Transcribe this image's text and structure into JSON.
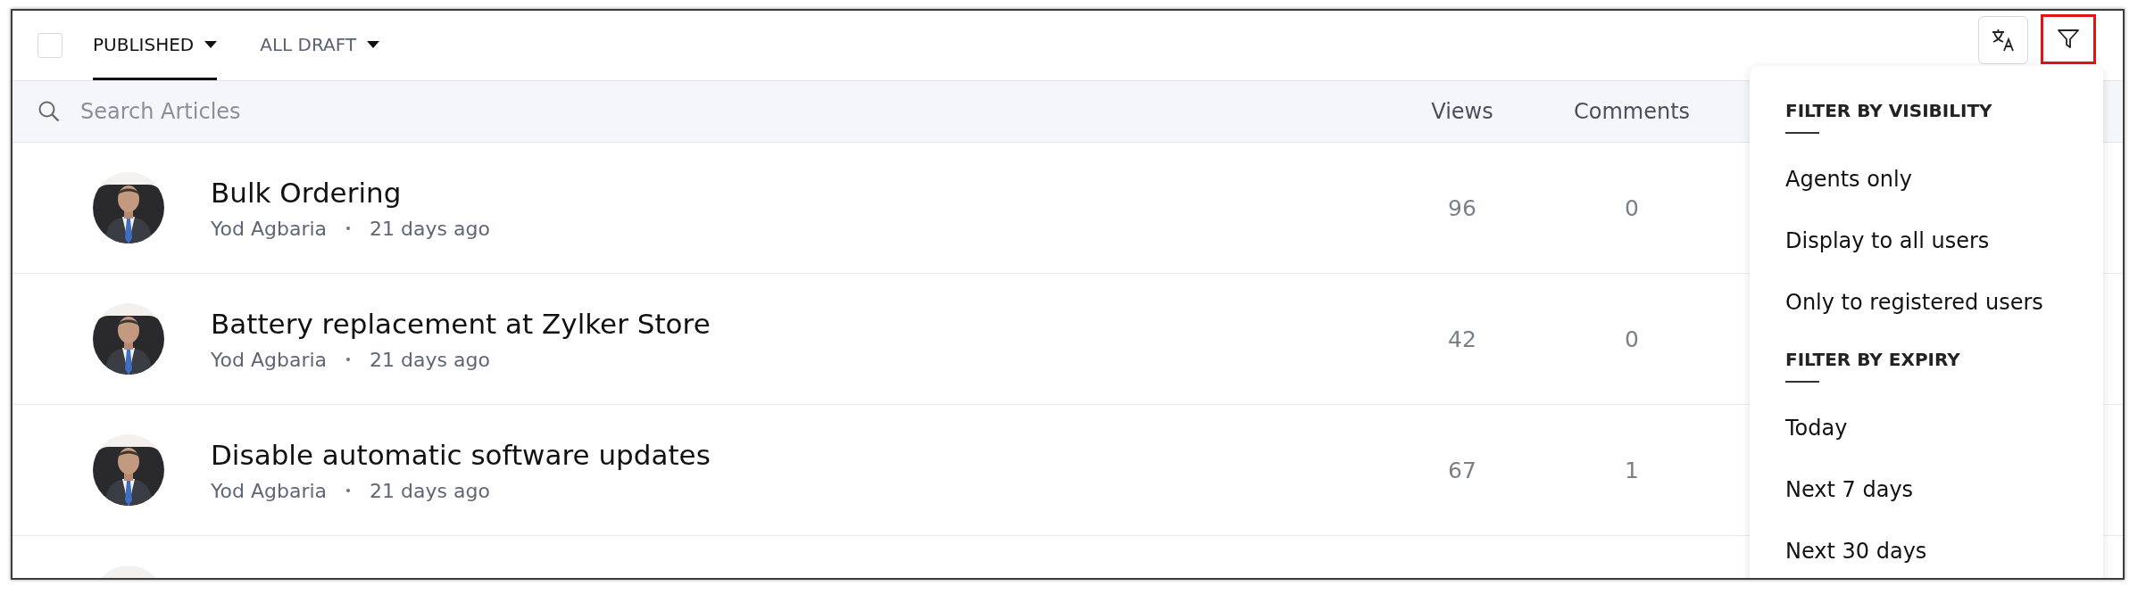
{
  "select_all": {
    "checked": false
  },
  "tabs": [
    {
      "label": "PUBLISHED",
      "selected": true
    },
    {
      "label": "ALL DRAFT",
      "selected": false
    }
  ],
  "filter_button": {
    "highlighted": true
  },
  "search": {
    "placeholder": "Search Articles"
  },
  "table": {
    "columns": [
      "Views",
      "Comments"
    ],
    "rows": [
      {
        "avatar": {
          "kind": "picture"
        },
        "title": "Bulk Ordering",
        "author": "Yod Agbaria",
        "time": "21 days ago",
        "views": "96",
        "comments": "0"
      },
      {
        "avatar": {
          "kind": "picture"
        },
        "title": "Battery replacement at Zylker Store",
        "author": "Yod Agbaria",
        "time": "21 days ago",
        "views": "42",
        "comments": "0"
      },
      {
        "avatar": {
          "kind": "picture"
        },
        "title": "Disable automatic software updates",
        "author": "Yod Agbaria",
        "time": "21 days ago",
        "views": "67",
        "comments": "1"
      },
      {
        "avatar": {
          "kind": "picture"
        }
      }
    ]
  },
  "filter_menu": {
    "sections": [
      {
        "heading": "FILTER BY VISIBILITY",
        "items": [
          "Agents only",
          "Display to all users",
          "Only to registered users"
        ]
      },
      {
        "heading": "FILTER BY EXPIRY",
        "items": [
          "Today",
          "Next 7 days",
          "Next 30 days"
        ]
      }
    ]
  }
}
